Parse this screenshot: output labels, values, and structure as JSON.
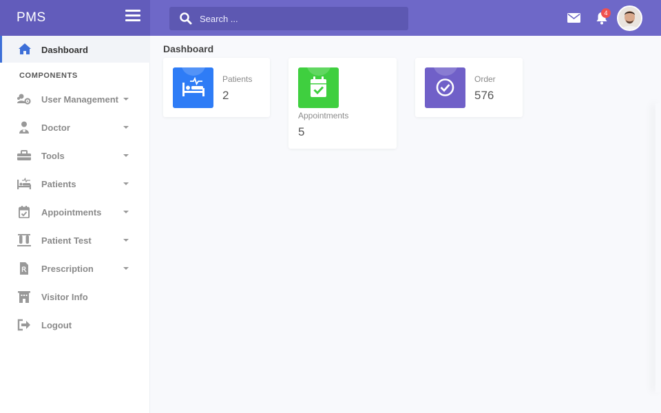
{
  "header": {
    "brand": "PMS",
    "search_placeholder": "Search ...",
    "notifications_count": "4",
    "colors": {
      "bar": "#6e68c8",
      "brand_bg": "#625cbb",
      "badge": "#f0514f"
    }
  },
  "sidebar": {
    "active": {
      "label": "Dashboard",
      "icon": "home-icon"
    },
    "section_title": "COMPONENTS",
    "items": [
      {
        "label": "User Management",
        "icon": "users-cog-icon",
        "has_caret": true
      },
      {
        "label": "Doctor",
        "icon": "doctor-icon",
        "has_caret": true
      },
      {
        "label": "Tools",
        "icon": "toolbox-icon",
        "has_caret": true
      },
      {
        "label": "Patients",
        "icon": "procedures-icon",
        "has_caret": true
      },
      {
        "label": "Appointments",
        "icon": "calendar-check-icon",
        "has_caret": true
      },
      {
        "label": "Patient Test",
        "icon": "vials-icon",
        "has_caret": true
      },
      {
        "label": "Prescription",
        "icon": "prescription-icon",
        "has_caret": true
      },
      {
        "label": "Visitor Info",
        "icon": "hotel-icon",
        "has_caret": false
      },
      {
        "label": "Logout",
        "icon": "sign-out-icon",
        "has_caret": false
      }
    ]
  },
  "main": {
    "title": "Dashboard",
    "cards": [
      {
        "label": "Patients",
        "value": "2",
        "color": "#2e7cf6",
        "icon": "bed-patient-icon"
      },
      {
        "label": "Appointments",
        "value": "5",
        "color": "#3fcf3f",
        "icon": "calendar-check-icon"
      },
      {
        "label": "Order",
        "value": "576",
        "color": "#7060c8",
        "icon": "check-circle-icon"
      }
    ]
  }
}
